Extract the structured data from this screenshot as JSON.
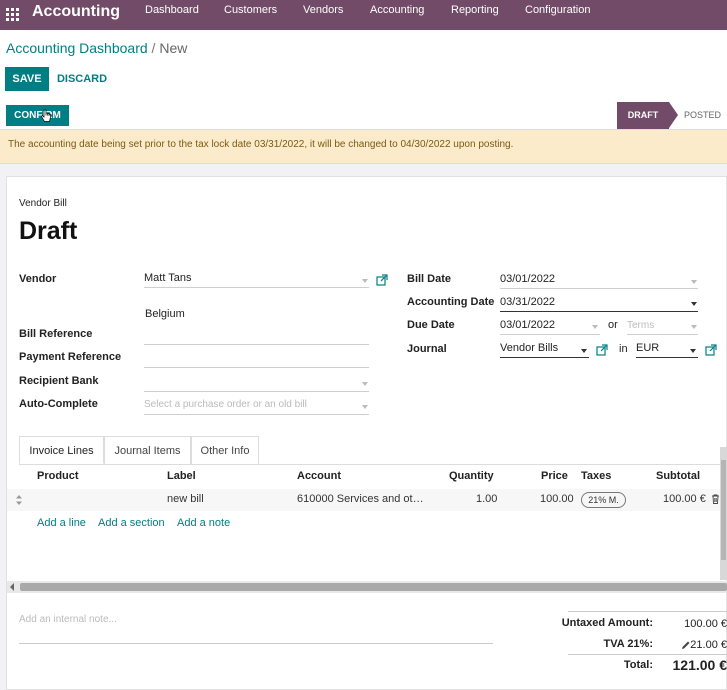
{
  "app": {
    "title": "Accounting",
    "menu": [
      "Dashboard",
      "Customers",
      "Vendors",
      "Accounting",
      "Reporting",
      "Configuration"
    ]
  },
  "breadcrumb": {
    "parent": "Accounting Dashboard",
    "separator": "/",
    "current": "New"
  },
  "buttons": {
    "save": "SAVE",
    "discard": "DISCARD",
    "confirm": "CONFIRM"
  },
  "status": {
    "draft": "DRAFT",
    "posted": "POSTED"
  },
  "alert": "The accounting date being set prior to the tax lock date 03/31/2022, it will be changed to 04/30/2022 upon posting.",
  "form": {
    "doc_type": "Vendor Bill",
    "state_title": "Draft",
    "vendor_label": "Vendor",
    "vendor_value": "Matt Tans",
    "vendor_country": "Belgium",
    "bill_reference_label": "Bill Reference",
    "payment_reference_label": "Payment Reference",
    "recipient_bank_label": "Recipient Bank",
    "auto_complete_label": "Auto-Complete",
    "auto_complete_placeholder": "Select a purchase order or an old bill",
    "bill_date_label": "Bill Date",
    "bill_date_value": "03/01/2022",
    "accounting_date_label": "Accounting Date",
    "accounting_date_value": "03/31/2022",
    "due_date_label": "Due Date",
    "due_date_value": "03/01/2022",
    "or_text": "or",
    "terms_placeholder": "Terms",
    "journal_label": "Journal",
    "journal_value": "Vendor Bills",
    "in_text": "in",
    "currency_value": "EUR"
  },
  "tabs": [
    "Invoice Lines",
    "Journal Items",
    "Other Info"
  ],
  "table": {
    "headers": [
      "Product",
      "Label",
      "Account",
      "Quantity",
      "Price",
      "Taxes",
      "Subtotal"
    ],
    "rows": [
      {
        "product": "",
        "label": "new bill",
        "account": "610000 Services and ot…",
        "quantity": "1.00",
        "price": "100.00",
        "taxes": "21% M.",
        "subtotal": "100.00 €"
      }
    ],
    "add_line": "Add a line",
    "add_section": "Add a section",
    "add_note": "Add a note"
  },
  "footer": {
    "note_placeholder": "Add an internal note...",
    "untaxed_label": "Untaxed Amount:",
    "untaxed_value": "100.00 €",
    "tax_label": "TVA 21%:",
    "tax_value": "21.00 €",
    "total_label": "Total:",
    "total_value": "121.00 €"
  },
  "colors": {
    "brand": "#714b67",
    "primary": "#017e84",
    "alert_bg": "#fcebcb"
  }
}
